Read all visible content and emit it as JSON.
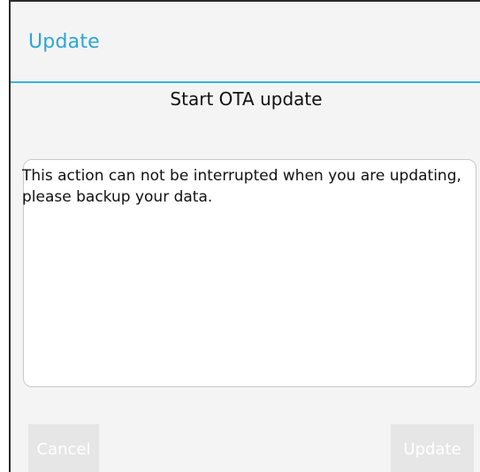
{
  "dialog": {
    "title": "Update",
    "subtitle": "Start OTA update",
    "message": "This action can not be interrupted when you are updating, please backup your data.",
    "buttons": {
      "cancel_label": "Cancel",
      "update_label": "Update"
    }
  },
  "colors": {
    "accent": "#2aa6d9",
    "divider": "#35b4e0",
    "button_disabled_bg": "#e6e6e6",
    "button_disabled_text": "#ffffff"
  }
}
